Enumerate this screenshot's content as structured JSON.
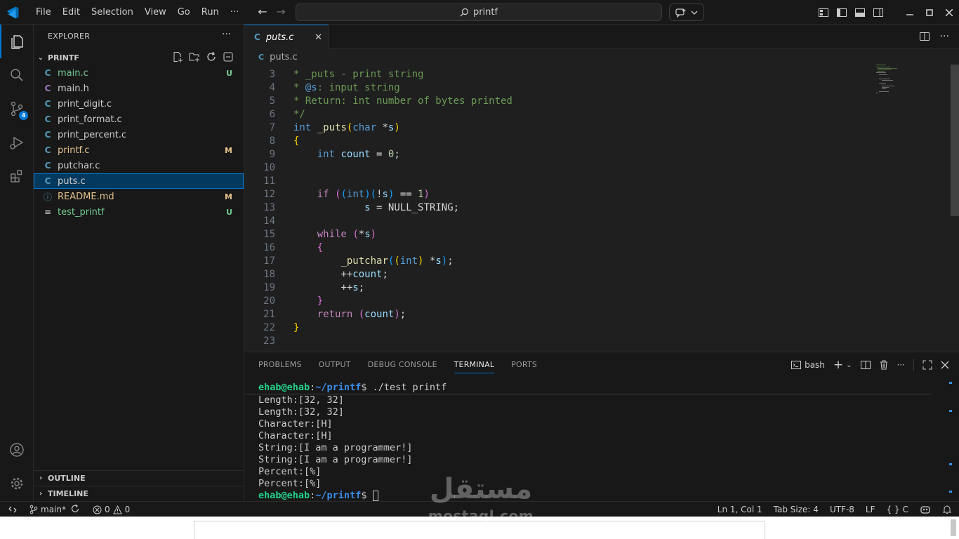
{
  "menu": [
    "File",
    "Edit",
    "Selection",
    "View",
    "Go",
    "Run",
    "···"
  ],
  "search": {
    "text": "printf"
  },
  "explorer": {
    "title": "EXPLORER",
    "folder": "PRINTF",
    "files": [
      {
        "icon": "C",
        "name": "main.c",
        "status": "U",
        "state": "untracked"
      },
      {
        "icon": "C",
        "name": "main.h",
        "status": "",
        "state": "plain"
      },
      {
        "icon": "C",
        "name": "print_digit.c",
        "status": "",
        "state": "plain"
      },
      {
        "icon": "C",
        "name": "print_format.c",
        "status": "",
        "state": "plain"
      },
      {
        "icon": "C",
        "name": "print_percent.c",
        "status": "",
        "state": "plain"
      },
      {
        "icon": "C",
        "name": "printf.c",
        "status": "M",
        "state": "plain"
      },
      {
        "icon": "C",
        "name": "putchar.c",
        "status": "",
        "state": "plain"
      },
      {
        "icon": "C",
        "name": "puts.c",
        "status": "",
        "state": "selected"
      },
      {
        "icon": "ⓘ",
        "name": "README.md",
        "status": "M",
        "state": "plain"
      },
      {
        "icon": "≡",
        "name": "test_printf",
        "status": "U",
        "state": "plain"
      }
    ],
    "outline": "OUTLINE",
    "timeline": "TIMELINE"
  },
  "activity": {
    "scm_badge": "4"
  },
  "editor": {
    "tab": {
      "icon": "C",
      "name": "puts.c"
    },
    "breadcrumb": "puts.c",
    "lines": [
      {
        "num": "3",
        "html": "<span class='cm'>* _puts - print string</span>"
      },
      {
        "num": "4",
        "html": "<span class='cm'>* </span><span class='k'>@s</span><span class='cm'>: input string</span>"
      },
      {
        "num": "5",
        "html": "<span class='cm'>* Return: int number of bytes printed</span>"
      },
      {
        "num": "6",
        "html": "<span class='cm'>*/</span>"
      },
      {
        "num": "7",
        "html": "<span class='k'>int</span> <span class='fn'>_puts</span><span class='b1'>(</span><span class='k'>char</span> <span class='p'>*</span><span class='v'>s</span><span class='b1'>)</span>"
      },
      {
        "num": "8",
        "html": "<span class='b1'>{</span>"
      },
      {
        "num": "9",
        "html": "    <span class='k'>int</span> <span class='v'>count</span> <span class='p'>=</span> <span class='n'>0</span><span class='p'>;</span>"
      },
      {
        "num": "10",
        "html": ""
      },
      {
        "num": "11",
        "html": ""
      },
      {
        "num": "12",
        "html": "    <span class='kc'>if</span> <span class='b2'>(</span><span class='b3'>(</span><span class='k'>int</span><span class='b3'>)</span><span class='b3'>(</span><span class='p'>!</span><span class='v'>s</span><span class='b3'>)</span> <span class='p'>==</span> <span class='n'>1</span><span class='b2'>)</span>"
      },
      {
        "num": "13",
        "html": "            <span class='v'>s</span> <span class='p'>=</span> <span class='p'>NULL_STRING;</span>"
      },
      {
        "num": "14",
        "html": ""
      },
      {
        "num": "15",
        "html": "    <span class='kc'>while</span> <span class='b2'>(</span><span class='p'>*</span><span class='v'>s</span><span class='b2'>)</span>"
      },
      {
        "num": "16",
        "html": "    <span class='b2'>{</span>"
      },
      {
        "num": "17",
        "html": "        <span class='fn'>_putchar</span><span class='b3'>(</span><span class='b1'>(</span><span class='k'>int</span><span class='b1'>)</span> <span class='p'>*</span><span class='v'>s</span><span class='b3'>)</span><span class='p'>;</span>"
      },
      {
        "num": "18",
        "html": "        <span class='p'>++</span><span class='v'>count</span><span class='p'>;</span>"
      },
      {
        "num": "19",
        "html": "        <span class='p'>++</span><span class='v'>s</span><span class='p'>;</span>"
      },
      {
        "num": "20",
        "html": "    <span class='b2'>}</span>"
      },
      {
        "num": "21",
        "html": "    <span class='kc'>return</span> <span class='b2'>(</span><span class='v'>count</span><span class='b2'>)</span><span class='p'>;</span>"
      },
      {
        "num": "22",
        "html": "<span class='b1'>}</span>"
      },
      {
        "num": "23",
        "html": ""
      }
    ]
  },
  "panel": {
    "tabs": [
      "PROBLEMS",
      "OUTPUT",
      "DEBUG CONSOLE",
      "TERMINAL",
      "PORTS"
    ],
    "active_tab": "TERMINAL",
    "shell": "bash",
    "prompt_user": "ehab@ehab",
    "prompt_path": "~/printf",
    "command": "./test printf",
    "output": [
      "Length:[32, 32]",
      "Length:[32, 32]",
      "Character:[H]",
      "Character:[H]",
      "String:[I am a programmer!]",
      "String:[I am a programmer!]",
      "Percent:[%]",
      "Percent:[%]"
    ]
  },
  "statusbar": {
    "branch": "main*",
    "errors": "0",
    "warnings": "0",
    "position": "Ln 1, Col 1",
    "tab_size": "Tab Size: 4",
    "encoding": "UTF-8",
    "eol": "LF",
    "language": "C"
  },
  "watermark": {
    "arabic": "مستقل",
    "latin": "mostaql.com"
  }
}
